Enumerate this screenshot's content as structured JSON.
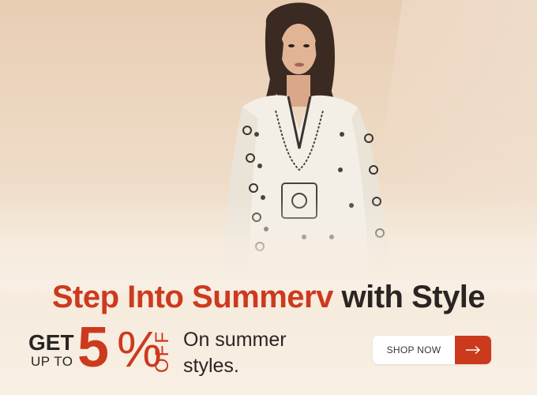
{
  "banner": {
    "headline_accent": "Step Into Summerv",
    "headline_rest": "with Style",
    "offer": {
      "get": "GET",
      "up_to": "UP TO",
      "number": "5",
      "percent": "%",
      "off": "OFF",
      "description": "On summer styles."
    },
    "cta": {
      "label": "SHOP NOW",
      "icon": "arrow-right-icon"
    }
  },
  "colors": {
    "accent": "#cc3a1e",
    "text_dark": "#2a2523",
    "background": "#f4e6d6"
  }
}
